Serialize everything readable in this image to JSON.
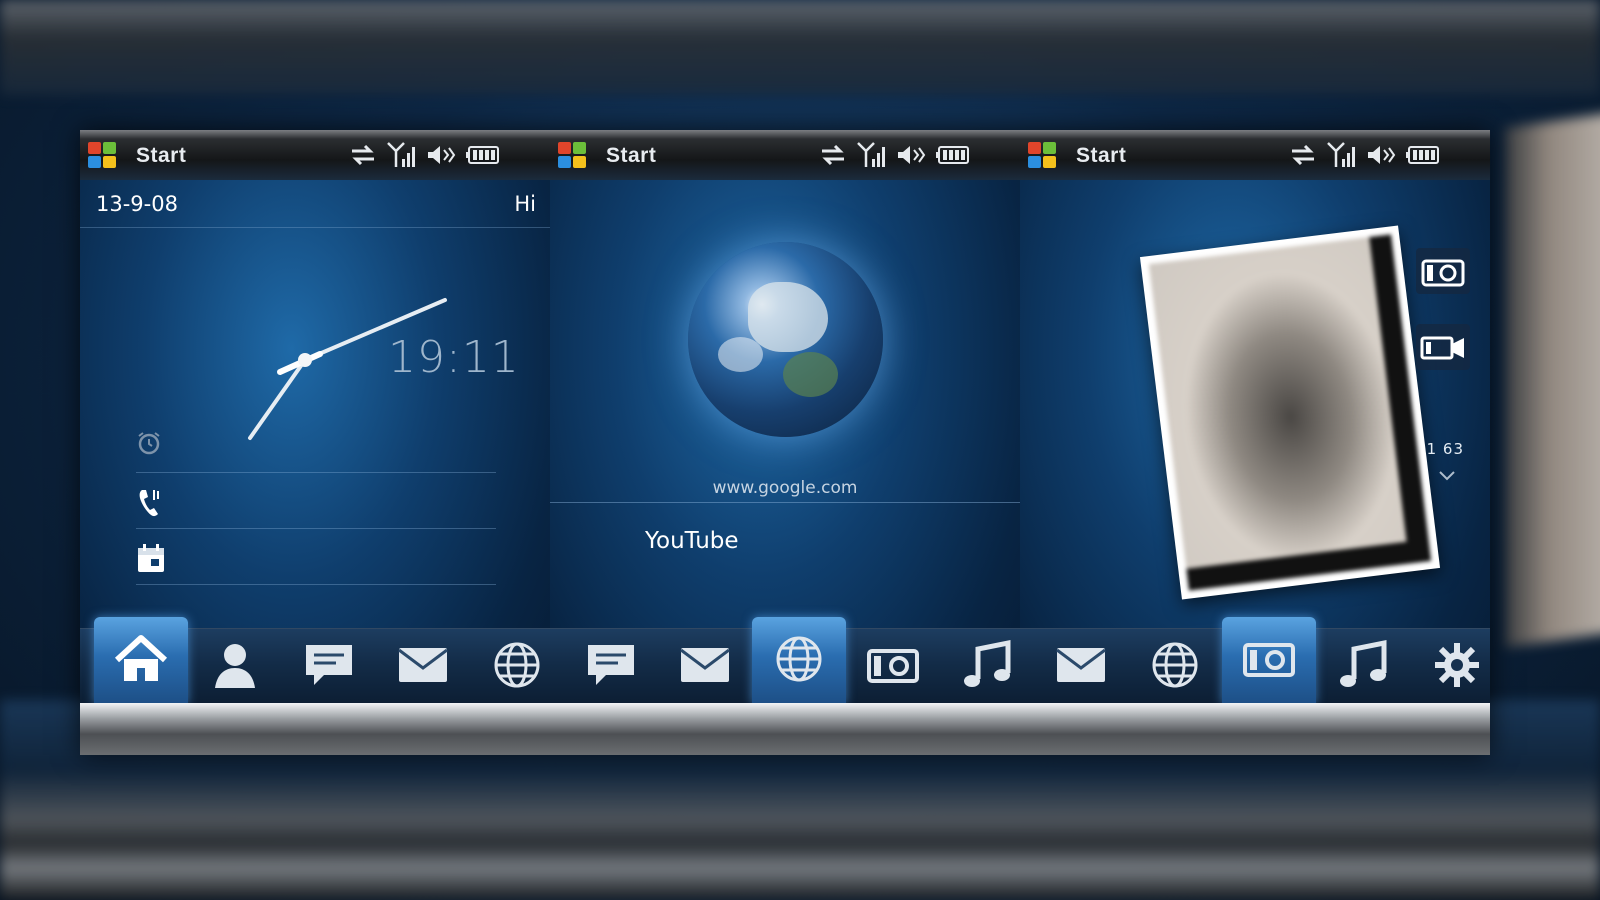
{
  "screens": [
    {
      "status": {
        "start_label": "Start"
      },
      "date": "13-9-08",
      "greeting": "Hi",
      "time": "19:11"
    },
    {
      "status": {
        "start_label": "Start"
      },
      "url": "www.google.com",
      "bookmark": "YouTube"
    },
    {
      "status": {
        "start_label": "Start"
      },
      "photo_counter": "1 63"
    }
  ],
  "tabbar": {
    "tabs": [
      {
        "icon": "home-icon",
        "active": true
      },
      {
        "icon": "person-icon",
        "active": false
      },
      {
        "icon": "message-icon",
        "active": false
      },
      {
        "icon": "mail-icon",
        "active": false
      },
      {
        "icon": "globe-icon",
        "active": false
      },
      {
        "icon": "message-icon",
        "active": false
      },
      {
        "icon": "mail-icon",
        "active": false
      },
      {
        "icon": "globe-icon",
        "active": true
      },
      {
        "icon": "camera-icon",
        "active": false
      },
      {
        "icon": "music-icon",
        "active": false
      },
      {
        "icon": "mail-icon",
        "active": false
      },
      {
        "icon": "globe-icon",
        "active": false
      },
      {
        "icon": "camera-icon",
        "active": true
      },
      {
        "icon": "music-icon",
        "active": false
      },
      {
        "icon": "settings-icon",
        "active": false
      }
    ]
  },
  "colors": {
    "accent": "#2a6db0",
    "background": "#0d2745"
  }
}
